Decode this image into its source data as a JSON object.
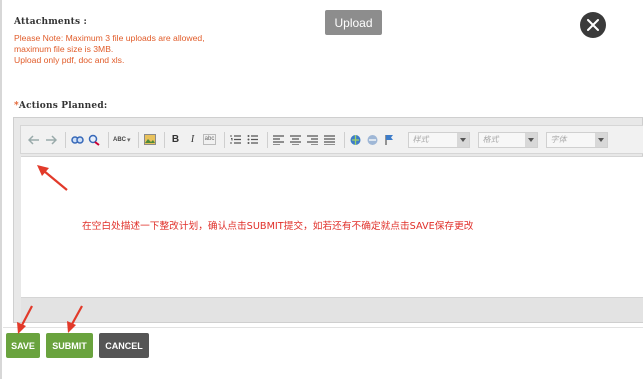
{
  "attachments": {
    "label": "Attachments :",
    "note_lines": [
      "Please Note: Maximum 3 file uploads are allowed,",
      "maximum file size is 3MB.",
      "Upload only pdf, doc and xls."
    ]
  },
  "upload_button": "Upload",
  "close_button": {
    "icon": "close-icon",
    "symbol": "✕"
  },
  "actions_planned": {
    "required_mark": "*",
    "label": "Actions Planned:"
  },
  "toolbar": {
    "icons": [
      "undo-icon",
      "redo-icon",
      "find-icon",
      "replace-icon",
      "spellcheck-icon",
      "image-icon",
      "bold-icon",
      "italic-icon",
      "strikethrough-icon",
      "ordered-list-icon",
      "unordered-list-icon",
      "align-left-icon",
      "align-center-icon",
      "align-right-icon",
      "align-justify-icon",
      "link-icon",
      "unlink-icon",
      "anchor-icon"
    ],
    "bold": "B",
    "italic": "I",
    "strike": "abc",
    "spell": "ABC",
    "style_combo": "样式",
    "format_combo": "格式",
    "font_combo": "字体"
  },
  "editor": {
    "instruction": "在空白处描述一下整改计划，确认点击SUBMIT提交，如若还有不确定就点击SAVE保存更改"
  },
  "buttons": {
    "save": "SAVE",
    "submit": "SUBMIT",
    "cancel": "CANCEL"
  },
  "colors": {
    "note_text": "#e15c2a",
    "instruction_text": "#e0302a",
    "annotation_arrow": "#e23a2a",
    "save_submit_bg": "#6aa33e",
    "cancel_bg": "#555555",
    "upload_bg": "#8d8d8d"
  }
}
